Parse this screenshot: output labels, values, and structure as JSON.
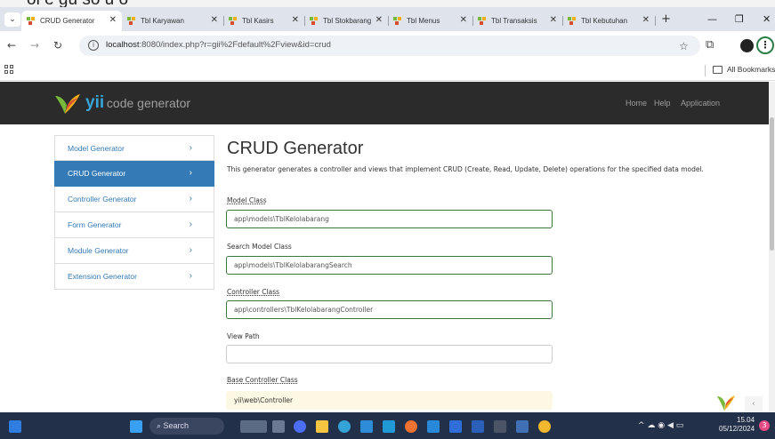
{
  "browser": {
    "partial_text": "ol e gu so u o",
    "tabs": [
      {
        "label": "CRUD Generator",
        "active": true
      },
      {
        "label": "Tbl Karyawan",
        "active": false
      },
      {
        "label": "Tbl Kasirs",
        "active": false
      },
      {
        "label": "Tbl Stokbarang",
        "active": false
      },
      {
        "label": "Tbl Menus",
        "active": false
      },
      {
        "label": "Tbl Transaksis",
        "active": false
      },
      {
        "label": "Tbl Kebutuhan",
        "active": false
      }
    ],
    "url_host": "localhost",
    "url_rest": ":8080/index.php?r=gii%2Fdefault%2Fview&id=crud",
    "bookmarks_label": "All Bookmarks"
  },
  "site": {
    "logo_yii": "yii",
    "logo_text": "code generator",
    "nav": [
      "Home",
      "Help",
      "Application"
    ]
  },
  "sidebar": {
    "items": [
      {
        "label": "Model Generator",
        "active": false
      },
      {
        "label": "CRUD Generator",
        "active": true
      },
      {
        "label": "Controller Generator",
        "active": false
      },
      {
        "label": "Form Generator",
        "active": false
      },
      {
        "label": "Module Generator",
        "active": false
      },
      {
        "label": "Extension Generator",
        "active": false
      }
    ]
  },
  "main": {
    "title": "CRUD Generator",
    "description": "This generator generates a controller and views that implement CRUD (Create, Read, Update, Delete) operations for the specified data model.",
    "fields": [
      {
        "label": "Model Class",
        "value": "app\\models\\TblKelolabarang"
      },
      {
        "label": "Search Model Class",
        "value": "app\\models\\TblKelolabarangSearch"
      },
      {
        "label": "Controller Class",
        "value": "app\\controllers\\TblKelolabarangController"
      },
      {
        "label": "View Path",
        "value": ""
      },
      {
        "label": "Base Controller Class",
        "value": "yii\\web\\Controller"
      }
    ]
  },
  "taskbar": {
    "search_label": "Search",
    "time": "15.04",
    "date": "05/12/2024",
    "notifications": "3"
  },
  "colors": {
    "accent": "#337ab7",
    "header_bg": "#2b2b2b",
    "valid_border": "#3c763d",
    "warning_bg": "#fcf8e3",
    "taskbar_bg": "#22304a"
  }
}
